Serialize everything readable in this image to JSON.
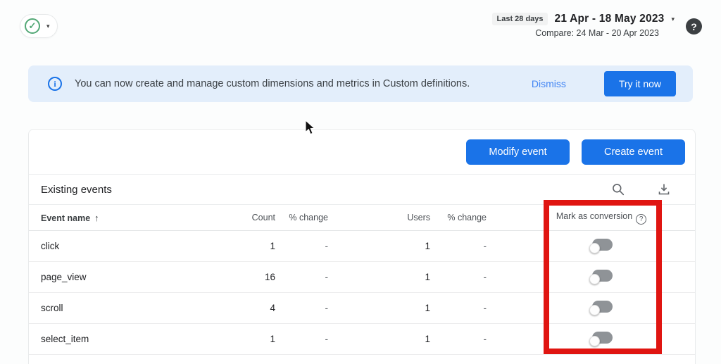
{
  "colors": {
    "accent_blue": "#1a73e8",
    "banner_bg": "#e3eefb",
    "highlight_red": "#e01511",
    "toggle_gray": "#8f9397",
    "success_green": "#53a876"
  },
  "icons": {
    "check": "✓",
    "caret_down": "▾",
    "sort_up": "↑",
    "help": "?",
    "info": "i",
    "question": "?"
  },
  "header": {
    "date_preset": "Last 28 days",
    "date_range": "21 Apr - 18 May 2023",
    "compare": "Compare: 24 Mar - 20 Apr 2023"
  },
  "banner": {
    "text": "You can now create and manage custom dimensions and metrics in Custom definitions.",
    "dismiss_label": "Dismiss",
    "cta_label": "Try it now"
  },
  "toolbar": {
    "modify_label": "Modify event",
    "create_label": "Create event"
  },
  "table": {
    "title": "Existing events",
    "headers": {
      "name": "Event name",
      "count": "Count",
      "count_change": "% change",
      "users": "Users",
      "users_change": "% change",
      "conversion": "Mark as conversion"
    },
    "rows": [
      {
        "name": "click",
        "count": "1",
        "count_change": "-",
        "users": "1",
        "users_change": "-",
        "conversion_on": false
      },
      {
        "name": "page_view",
        "count": "16",
        "count_change": "-",
        "users": "1",
        "users_change": "-",
        "conversion_on": false
      },
      {
        "name": "scroll",
        "count": "4",
        "count_change": "-",
        "users": "1",
        "users_change": "-",
        "conversion_on": false
      },
      {
        "name": "select_item",
        "count": "1",
        "count_change": "-",
        "users": "1",
        "users_change": "-",
        "conversion_on": false
      }
    ]
  }
}
